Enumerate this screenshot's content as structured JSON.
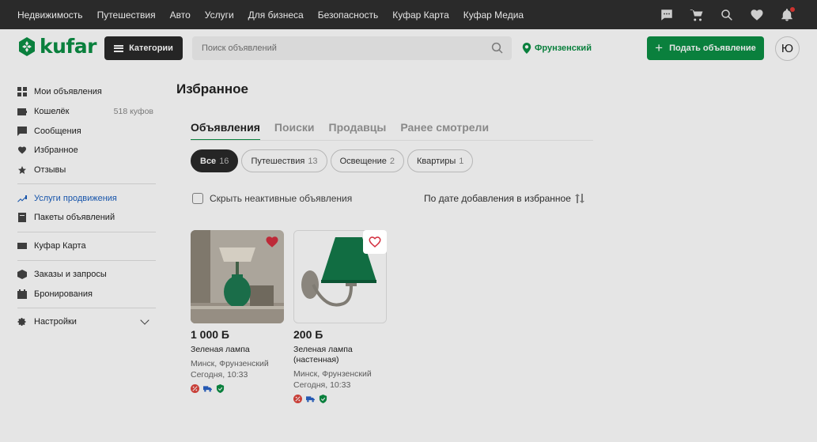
{
  "topbar": {
    "links": [
      "Недвижимость",
      "Путешествия",
      "Авто",
      "Услуги",
      "Для бизнеса",
      "Безопасность",
      "Куфар Карта",
      "Куфар Медиа"
    ],
    "icons": [
      "chat-icon",
      "cart-icon",
      "saved-search-icon",
      "heart-icon",
      "bell-icon"
    ]
  },
  "header": {
    "logo_text": "kufar",
    "categories_label": "Категории",
    "search_placeholder": "Поиск объявлений",
    "location": "Фрунзенский",
    "post_label": "Подать объявление",
    "avatar_letter": "Ю"
  },
  "sidebar": {
    "items": [
      {
        "label": "Мои объявления",
        "icon": "grid-icon"
      },
      {
        "label": "Кошелёк",
        "icon": "wallet-icon",
        "count": "518 куфов"
      },
      {
        "label": "Сообщения",
        "icon": "message-icon"
      },
      {
        "label": "Избранное",
        "icon": "heart-icon"
      },
      {
        "label": "Отзывы",
        "icon": "star-icon"
      },
      {
        "label": "Услуги продвижения",
        "icon": "trend-icon"
      },
      {
        "label": "Пакеты объявлений",
        "icon": "package-icon"
      },
      {
        "label": "Куфар Карта",
        "icon": "card-icon"
      },
      {
        "label": "Заказы и запросы",
        "icon": "box-icon"
      },
      {
        "label": "Бронирования",
        "icon": "calendar-icon"
      },
      {
        "label": "Настройки",
        "icon": "gear-icon"
      }
    ]
  },
  "main": {
    "title": "Избранное",
    "tabs": [
      "Объявления",
      "Поиски",
      "Продавцы",
      "Ранее смотрели"
    ],
    "chips": [
      {
        "label": "Все",
        "count": "16"
      },
      {
        "label": "Путешествия",
        "count": "13"
      },
      {
        "label": "Освещение",
        "count": "2"
      },
      {
        "label": "Квартиры",
        "count": "1"
      }
    ],
    "hide_inactive_label": "Скрыть неактивные объявления",
    "sort_label": "По дате добавления в избранное"
  },
  "ads": [
    {
      "price": "1 000 Б",
      "title": "Зеленая лампа",
      "location": "Минск, Фрунзенский",
      "date": "Сегодня, 10:33"
    },
    {
      "price": "200 Б",
      "title": "Зеленая лампа (настенная)",
      "location": "Минск, Фрунзенский",
      "date": "Сегодня, 10:33"
    }
  ],
  "colors": {
    "brand_green": "#0c8f45",
    "topbar_bg": "#2f2f2f",
    "favorite_red": "#d32f3f"
  }
}
